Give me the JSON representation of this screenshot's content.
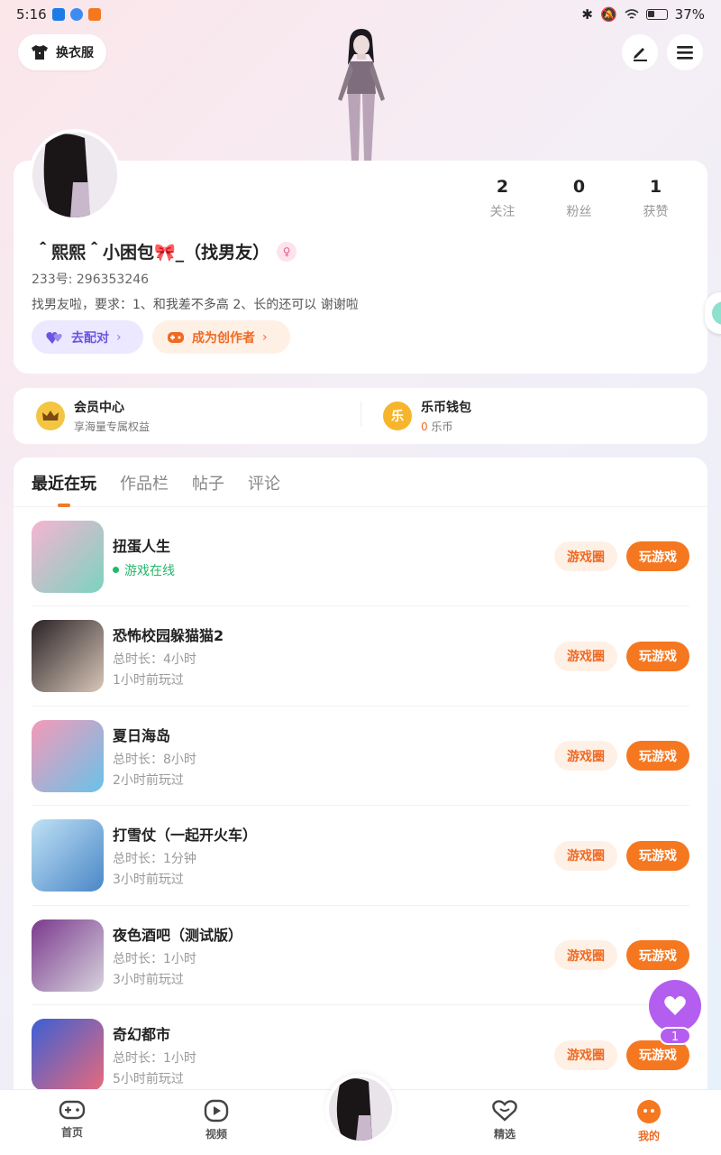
{
  "status": {
    "time": "5:16",
    "battery": "37%"
  },
  "header": {
    "wardrobe_label": "换衣服"
  },
  "profile": {
    "username": "＾熙熙＾小困包🎀_（找男友）",
    "uid": "233号:  296353246",
    "bio": "找男友啦，要求：1、和我差不多高  2、长的还可以  谢谢啦",
    "stats": [
      {
        "num": "2",
        "label": "关注"
      },
      {
        "num": "0",
        "label": "粉丝"
      },
      {
        "num": "1",
        "label": "获赞"
      }
    ],
    "match_label": "去配对",
    "creator_label": "成为创作者"
  },
  "member": {
    "vip_title": "会员中心",
    "vip_sub": "享海量专属权益",
    "wallet_title": "乐币钱包",
    "wallet_coin": "乐",
    "wallet_amount": "0",
    "wallet_unit": "乐币"
  },
  "tabs": [
    "最近在玩",
    "作品栏",
    "帖子",
    "评论"
  ],
  "games": [
    {
      "name": "扭蛋人生",
      "line1": "游戏在线",
      "line2": "",
      "online": true,
      "colors": [
        "#f6b4d1",
        "#7bd3c0"
      ]
    },
    {
      "name": "恐怖校园躲猫猫2",
      "line1": "总时长：4小时",
      "line2": "1小时前玩过",
      "online": false,
      "colors": [
        "#2a2226",
        "#d8c7b8"
      ]
    },
    {
      "name": "夏日海岛",
      "line1": "总时长：8小时",
      "line2": "2小时前玩过",
      "online": false,
      "colors": [
        "#f59ab8",
        "#69c2e9"
      ]
    },
    {
      "name": "打雪仗（一起开火车）",
      "line1": "总时长：1分钟",
      "line2": "3小时前玩过",
      "online": false,
      "colors": [
        "#bfe1f5",
        "#4a87c7"
      ]
    },
    {
      "name": "夜色酒吧（测试版）",
      "line1": "总时长：1小时",
      "line2": "3小时前玩过",
      "online": false,
      "colors": [
        "#7b3a8e",
        "#d7d3dd"
      ]
    },
    {
      "name": "奇幻都市",
      "line1": "总时长：1小时",
      "line2": "5小时前玩过",
      "online": false,
      "colors": [
        "#3c5fd4",
        "#e86a7c"
      ]
    }
  ],
  "game_buttons": {
    "circle": "游戏圈",
    "play": "玩游戏"
  },
  "float": {
    "count": "1"
  },
  "nav": [
    {
      "label": "首页",
      "icon": "gamepad-icon"
    },
    {
      "label": "视频",
      "icon": "play-icon"
    },
    {
      "label": "",
      "icon": "avatar"
    },
    {
      "label": "精选",
      "icon": "heart-outline-icon"
    },
    {
      "label": "我的",
      "icon": "face-icon"
    }
  ],
  "colors": {
    "accent": "#f5771f",
    "purple": "#b45ef0",
    "online": "#21b86a"
  }
}
